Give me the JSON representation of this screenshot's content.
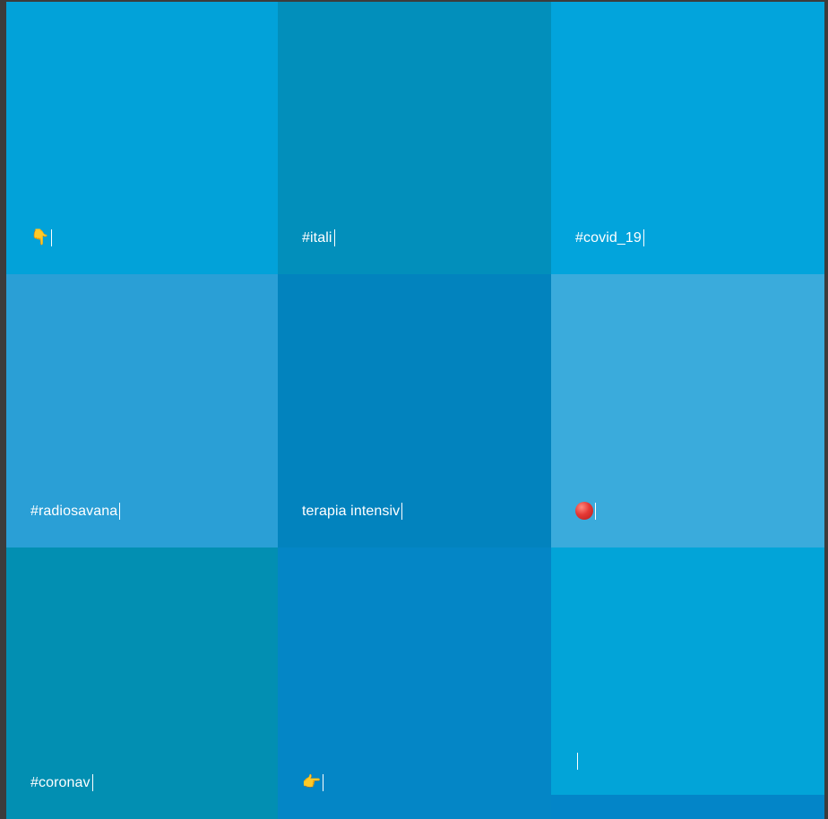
{
  "tiles": [
    {
      "id": "t1",
      "text": "👇",
      "color": "#02a2d9",
      "is_emoji": true
    },
    {
      "id": "t2",
      "text": "#itali",
      "color": "#028fbb",
      "is_emoji": false
    },
    {
      "id": "t3",
      "text": "#covid_19",
      "color": "#02a4dc",
      "is_emoji": false
    },
    {
      "id": "t4",
      "text": "#radiosavana",
      "color": "#2a9fd6",
      "is_emoji": false
    },
    {
      "id": "t5",
      "text": "terapia intensiv",
      "color": "#0283be",
      "is_emoji": false
    },
    {
      "id": "t6",
      "text": "",
      "color": "#3aabdc",
      "icon": "red-circle-icon"
    },
    {
      "id": "t7",
      "text": "#coronav",
      "color": "#028fb2",
      "is_emoji": false
    },
    {
      "id": "t8",
      "text": "👉",
      "color": "#0486c6",
      "is_emoji": true
    },
    {
      "id": "t9",
      "text": "",
      "color": "#02a4d8",
      "is_emoji": false
    },
    {
      "id": "t10",
      "text": "",
      "color": "#0385c8",
      "is_emoji": false
    }
  ]
}
